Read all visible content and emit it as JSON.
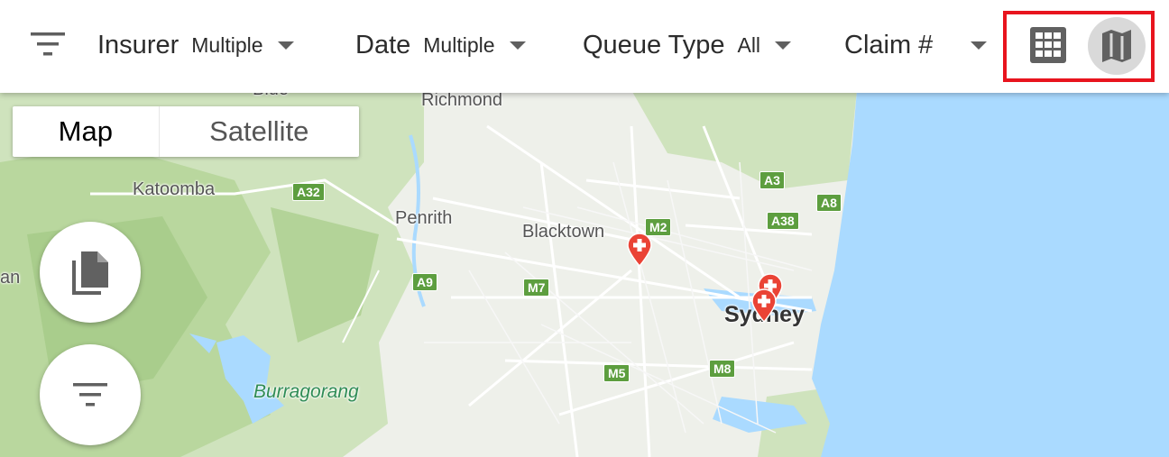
{
  "filters": [
    {
      "label": "Insurer",
      "value": "Multiple"
    },
    {
      "label": "Date",
      "value": "Multiple"
    },
    {
      "label": "Queue Type",
      "value": "All"
    },
    {
      "label": "Claim #",
      "value": ""
    }
  ],
  "view_toggle": {
    "grid_icon": "grid-view-icon",
    "map_icon": "map-view-icon",
    "active": "map",
    "highlight_color": "#e8141e"
  },
  "map_type": {
    "options": [
      "Map",
      "Satellite"
    ],
    "selected": "Map"
  },
  "map": {
    "places": [
      "Richmond",
      "Katoomba",
      "Penrith",
      "Blacktown",
      "Sydney",
      "Burragorang",
      "Blue",
      "an"
    ],
    "road_shields": [
      "A32",
      "M2",
      "A3",
      "A8",
      "A38",
      "A9",
      "M7",
      "M5",
      "M8"
    ],
    "markers": 3,
    "water_color": "#aadaff",
    "land_color": "#e9ece4",
    "forest_color": "#c5dfb2"
  },
  "fabs": [
    "documents-icon",
    "filter-list-icon"
  ]
}
